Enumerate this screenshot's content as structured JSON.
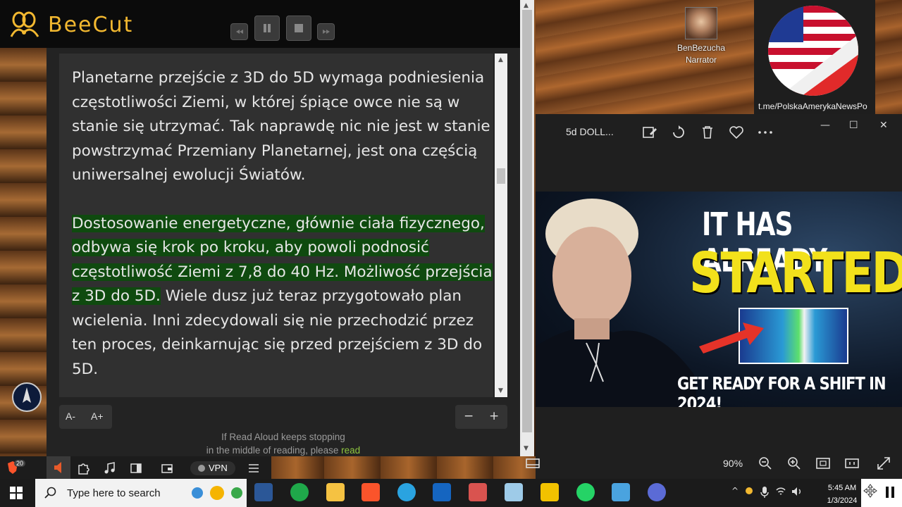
{
  "beecut": {
    "app_name": "BeeCut"
  },
  "reader": {
    "paragraph1": "Planetarne przejście z 3D do 5D wymaga podniesienia częstotliwości Ziemi, w której śpiące owce nie są w stanie się utrzymać. Tak naprawdę nic nie jest w stanie powstrzymać Przemiany Planetarnej, jest ona częścią uniwersalnej ewolucji Światów.",
    "paragraph2_highlighted": "Dostosowanie energetyczne, głównie ciała fizycznego, odbywa się krok po kroku, aby powoli podnosić częstotliwość Ziemi z 7,8 do 40 Hz. Możliwość przejścia z 3D do 5D.",
    "paragraph2_rest": " Wiele dusz już teraz przygotowało plan wcielenia. Inni zdecydowali się nie przechodzić przez ten proces, deinkarnując się przed przejściem z 3D do 5D.",
    "font_decrease": "A-",
    "font_increase": "A+",
    "zoom_out": "−",
    "zoom_in": "+",
    "note_line1": "If Read Aloud keeps stopping",
    "note_line2": "in the middle of reading, please ",
    "note_link": "read"
  },
  "narrator": {
    "name": "BenBezucha",
    "role": "Narrator"
  },
  "telegram_link": "t.me/PolskaAmerykaNewsPo",
  "photos": {
    "file_title": "5d DOLL...",
    "zoom": "90%",
    "thumbnail": {
      "line1": "IT HAS ALREADY",
      "line2": "STARTED!",
      "line3": "GET READY FOR A SHIFT IN 2024!"
    }
  },
  "browser": {
    "vpn_label": "VPN",
    "badge": "20"
  },
  "taskbar": {
    "search_placeholder": "Type here to search",
    "time": "5:45 AM",
    "date": "1/3/2024"
  },
  "colors": {
    "highlight": "#0f4a0f",
    "beecut_gold": "#f2b830",
    "thumbnail_yellow": "#f2e11b"
  }
}
